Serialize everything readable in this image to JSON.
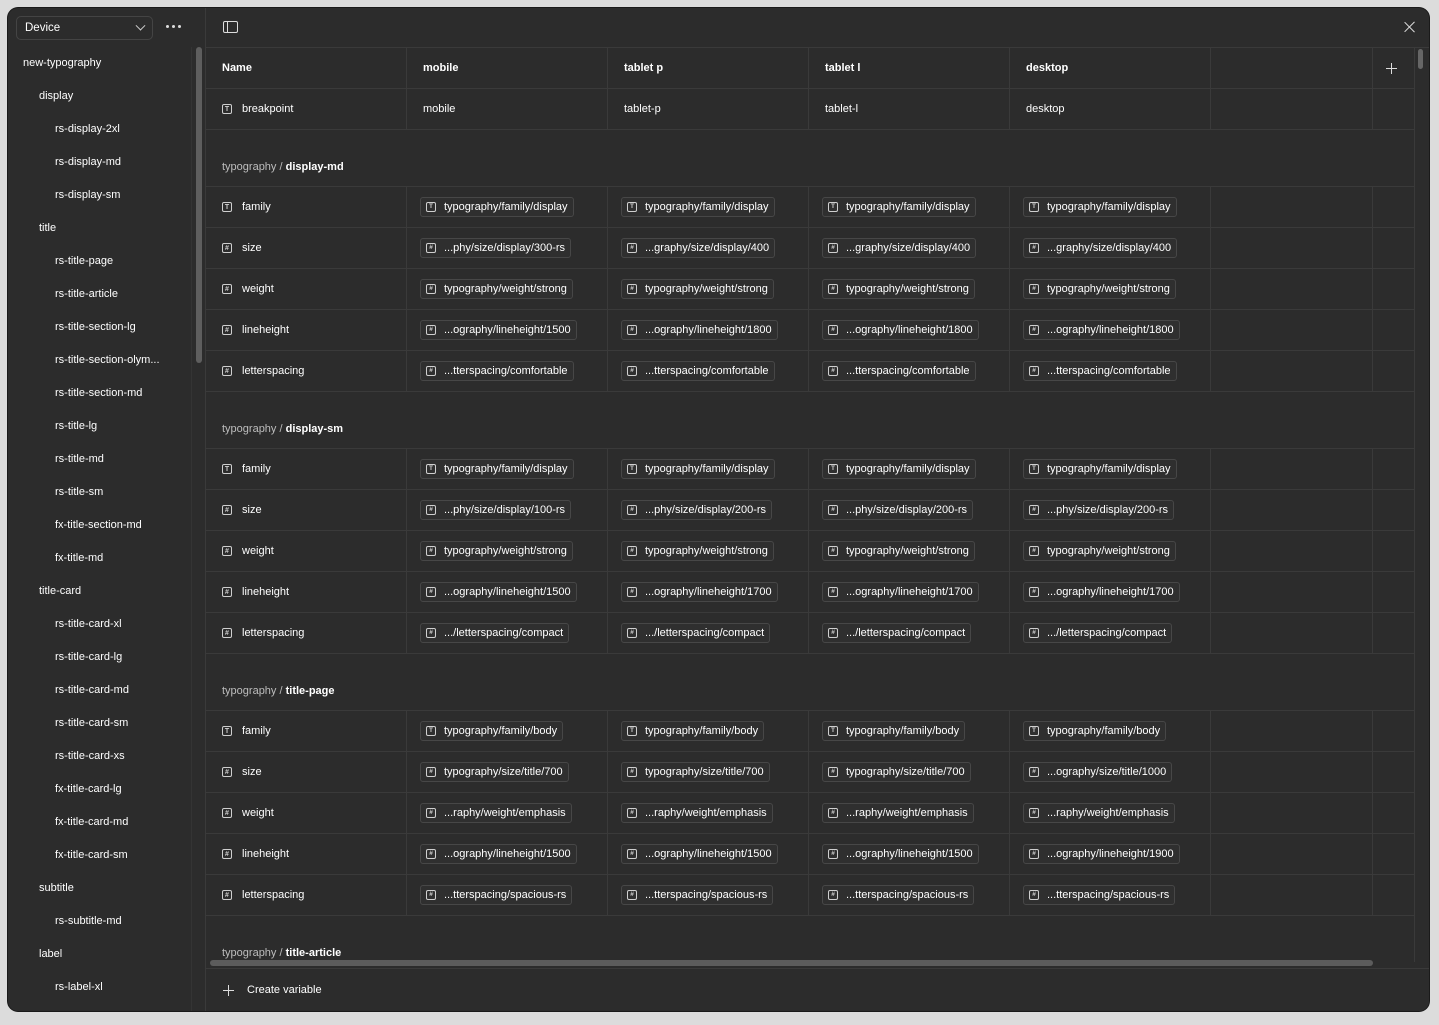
{
  "sidebar": {
    "mode_select": "Device",
    "tree": [
      {
        "label": "new-typography",
        "level": 0
      },
      {
        "label": "display",
        "level": 1
      },
      {
        "label": "rs-display-2xl",
        "level": 2
      },
      {
        "label": "rs-display-md",
        "level": 2
      },
      {
        "label": "rs-display-sm",
        "level": 2
      },
      {
        "label": "title",
        "level": 1
      },
      {
        "label": "rs-title-page",
        "level": 2
      },
      {
        "label": "rs-title-article",
        "level": 2
      },
      {
        "label": "rs-title-section-lg",
        "level": 2
      },
      {
        "label": "rs-title-section-olym...",
        "level": 2
      },
      {
        "label": "rs-title-section-md",
        "level": 2
      },
      {
        "label": "rs-title-lg",
        "level": 2
      },
      {
        "label": "rs-title-md",
        "level": 2
      },
      {
        "label": "rs-title-sm",
        "level": 2
      },
      {
        "label": "fx-title-section-md",
        "level": 2
      },
      {
        "label": "fx-title-md",
        "level": 2
      },
      {
        "label": "title-card",
        "level": 1
      },
      {
        "label": "rs-title-card-xl",
        "level": 2
      },
      {
        "label": "rs-title-card-lg",
        "level": 2
      },
      {
        "label": "rs-title-card-md",
        "level": 2
      },
      {
        "label": "rs-title-card-sm",
        "level": 2
      },
      {
        "label": "rs-title-card-xs",
        "level": 2
      },
      {
        "label": "fx-title-card-lg",
        "level": 2
      },
      {
        "label": "fx-title-card-md",
        "level": 2
      },
      {
        "label": "fx-title-card-sm",
        "level": 2
      },
      {
        "label": "subtitle",
        "level": 1
      },
      {
        "label": "rs-subtitle-md",
        "level": 2
      },
      {
        "label": "label",
        "level": 1
      },
      {
        "label": "rs-label-xl",
        "level": 2
      }
    ]
  },
  "table": {
    "columns": [
      "Name",
      "mobile",
      "tablet p",
      "tablet l",
      "desktop"
    ],
    "breakpoint_row": {
      "name": "breakpoint",
      "icon": "text-type-icon",
      "values": [
        "mobile",
        "tablet-p",
        "tablet-l",
        "desktop"
      ]
    },
    "groups": [
      {
        "prefix": "typography /",
        "name": "display-md",
        "rows": [
          {
            "name": "family",
            "icon": "text-type-icon",
            "values": [
              "typography/family/display",
              "typography/family/display",
              "typography/family/display",
              "typography/family/display"
            ]
          },
          {
            "name": "size",
            "icon": "number-type-icon",
            "values": [
              "...phy/size/display/300-rs",
              "...graphy/size/display/400",
              "...graphy/size/display/400",
              "...graphy/size/display/400"
            ]
          },
          {
            "name": "weight",
            "icon": "number-type-icon",
            "values": [
              "typography/weight/strong",
              "typography/weight/strong",
              "typography/weight/strong",
              "typography/weight/strong"
            ]
          },
          {
            "name": "lineheight",
            "icon": "number-type-icon",
            "values": [
              "...ography/lineheight/1500",
              "...ography/lineheight/1800",
              "...ography/lineheight/1800",
              "...ography/lineheight/1800"
            ]
          },
          {
            "name": "letterspacing",
            "icon": "number-type-icon",
            "values": [
              "...tterspacing/comfortable",
              "...tterspacing/comfortable",
              "...tterspacing/comfortable",
              "...tterspacing/comfortable"
            ]
          }
        ]
      },
      {
        "prefix": "typography /",
        "name": "display-sm",
        "rows": [
          {
            "name": "family",
            "icon": "text-type-icon",
            "values": [
              "typography/family/display",
              "typography/family/display",
              "typography/family/display",
              "typography/family/display"
            ]
          },
          {
            "name": "size",
            "icon": "number-type-icon",
            "values": [
              "...phy/size/display/100-rs",
              "...phy/size/display/200-rs",
              "...phy/size/display/200-rs",
              "...phy/size/display/200-rs"
            ]
          },
          {
            "name": "weight",
            "icon": "number-type-icon",
            "values": [
              "typography/weight/strong",
              "typography/weight/strong",
              "typography/weight/strong",
              "typography/weight/strong"
            ]
          },
          {
            "name": "lineheight",
            "icon": "number-type-icon",
            "values": [
              "...ography/lineheight/1500",
              "...ography/lineheight/1700",
              "...ography/lineheight/1700",
              "...ography/lineheight/1700"
            ]
          },
          {
            "name": "letterspacing",
            "icon": "number-type-icon",
            "values": [
              ".../letterspacing/compact",
              ".../letterspacing/compact",
              ".../letterspacing/compact",
              ".../letterspacing/compact"
            ]
          }
        ]
      },
      {
        "prefix": "typography /",
        "name": "title-page",
        "rows": [
          {
            "name": "family",
            "icon": "text-type-icon",
            "values": [
              "typography/family/body",
              "typography/family/body",
              "typography/family/body",
              "typography/family/body"
            ]
          },
          {
            "name": "size",
            "icon": "number-type-icon",
            "values": [
              "typography/size/title/700",
              "typography/size/title/700",
              "typography/size/title/700",
              "...ography/size/title/1000"
            ]
          },
          {
            "name": "weight",
            "icon": "number-type-icon",
            "values": [
              "...raphy/weight/emphasis",
              "...raphy/weight/emphasis",
              "...raphy/weight/emphasis",
              "...raphy/weight/emphasis"
            ]
          },
          {
            "name": "lineheight",
            "icon": "number-type-icon",
            "values": [
              "...ography/lineheight/1500",
              "...ography/lineheight/1500",
              "...ography/lineheight/1500",
              "...ography/lineheight/1900"
            ]
          },
          {
            "name": "letterspacing",
            "icon": "number-type-icon",
            "values": [
              "...tterspacing/spacious-rs",
              "...tterspacing/spacious-rs",
              "...tterspacing/spacious-rs",
              "...tterspacing/spacious-rs"
            ]
          }
        ]
      },
      {
        "prefix": "typography /",
        "name": "title-article",
        "rows": []
      }
    ]
  },
  "footer": {
    "create_label": "Create variable"
  }
}
